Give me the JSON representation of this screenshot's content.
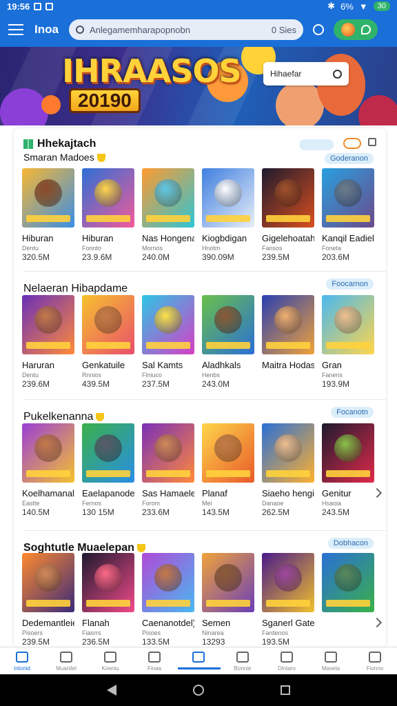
{
  "status": {
    "time": "19:56",
    "battery": "6%",
    "pill": "30"
  },
  "appbar": {
    "title": "Inoa",
    "search_placeholder": "Anlegamemharapopnobn",
    "search_right": "0 Sies"
  },
  "banner": {
    "title": "IHRAASOS",
    "year": "20190",
    "search_text": "Hihaefar"
  },
  "sections": [
    {
      "title": "Hhekajtach",
      "subtitle": "Smaran Madoes",
      "pill": "Goderanon",
      "cards": [
        {
          "name": "Hiburan",
          "meta": "Dentu",
          "size": "320.5M",
          "c1": "#f7b733",
          "c2": "#3a8ee6",
          "face": "#8b4a2a"
        },
        {
          "name": "Hiburan",
          "meta": "Fonnto",
          "size": "23.9.6M",
          "c1": "#2d6fd6",
          "c2": "#f35b9a",
          "face": "#ffd54a"
        },
        {
          "name": "Nas Hongena)",
          "meta": "Mornos",
          "size": "240.0M",
          "c1": "#ff9a2e",
          "c2": "#2ec4d6",
          "face": "#5fc9e8"
        },
        {
          "name": "Kiogbdigan",
          "meta": "Hnotm",
          "size": "390.09M",
          "c1": "#3f7fe0",
          "c2": "#e8eef8",
          "face": "#ffffff"
        },
        {
          "name": "Gigelehoatah",
          "meta": "Fansos",
          "size": "239.5M",
          "c1": "#1e1a2e",
          "c2": "#d94f1f",
          "face": "#a0522d"
        },
        {
          "name": "Kanqil Eadiel)",
          "meta": "Foneta",
          "size": "203.6M",
          "c1": "#2aa0e0",
          "c2": "#6b4a8a",
          "face": "#6e7b8a"
        }
      ]
    },
    {
      "title": "Nelaeran Hibapdame",
      "pill": "Foocarnon",
      "cards": [
        {
          "name": "Haruran",
          "meta": "Dentu",
          "size": "239.6M",
          "c1": "#6a2fb8",
          "c2": "#ff8a3a",
          "face": "#c47a4a"
        },
        {
          "name": "Genkatuile",
          "meta": "Rnnios",
          "size": "439.5M",
          "c1": "#f6c12e",
          "c2": "#e94f6b",
          "face": "#c47a4a"
        },
        {
          "name": "Sal Kamts",
          "meta": "Flniuco",
          "size": "237.5M",
          "c1": "#2ec4e6",
          "c2": "#d63fc6",
          "face": "#ffe14a"
        },
        {
          "name": "Aladhkals",
          "meta": "Henbs",
          "size": "243.0M",
          "c1": "#6ac04a",
          "c2": "#2a6fd6",
          "face": "#8b5a3a"
        },
        {
          "name": "Maitra Hodask",
          "meta": "",
          "size": "",
          "c1": "#2a3fb0",
          "c2": "#f0a23a",
          "face": "#f0b070"
        },
        {
          "name": "Gran",
          "meta": "Fanens",
          "size": "193.9M",
          "c1": "#4ab8f0",
          "c2": "#ffd54a",
          "face": "#f0c090"
        }
      ]
    },
    {
      "title": "Pukelkenanna",
      "pill": "Focanotn",
      "cards": [
        {
          "name": "Koelhamanal)",
          "meta": "Eastte",
          "size": "140.5M",
          "c1": "#9a3fd6",
          "c2": "#f5c12e",
          "face": "#c47a4a"
        },
        {
          "name": "Eaelapanodel)",
          "meta": "Fernos",
          "size": "130 15M",
          "c1": "#3ab04a",
          "c2": "#2a8ee6",
          "face": "#5a5a6a"
        },
        {
          "name": "Sas Hamaele",
          "meta": "Forom",
          "size": "233.6M",
          "c1": "#7a2fb8",
          "c2": "#ff8a3a",
          "face": "#d08a5a"
        },
        {
          "name": "Planaf",
          "meta": "Mei",
          "size": "143.5M",
          "c1": "#ffd54a",
          "c2": "#e85a2a",
          "face": "#c47a4a"
        },
        {
          "name": "Siaeho hengi",
          "meta": "Danaoe",
          "size": "262.5M",
          "c1": "#2a6fd6",
          "c2": "#ffb02e",
          "face": "#f0c090"
        },
        {
          "name": "Genitur",
          "meta": "Hsaoia",
          "size": "243.5M",
          "c1": "#1e1a2e",
          "c2": "#e02a4a",
          "face": "#8ac04a"
        }
      ]
    },
    {
      "title": "Soghtutle Muaelepan",
      "pill": "Dobhacon",
      "cards": [
        {
          "name": "Dedemantleie)",
          "meta": "Pisoers",
          "size": "239.5M",
          "c1": "#ff8a2e",
          "c2": "#3a2a7a",
          "face": "#d08a5a"
        },
        {
          "name": "Flanah",
          "meta": "Fiasrrs",
          "size": "236.5M",
          "c1": "#1e1a2e",
          "c2": "#f04a8a",
          "face": "#ff6a8a"
        },
        {
          "name": "Caenanotdel)",
          "meta": "Pisoes",
          "size": "133.5M",
          "c1": "#b04ad6",
          "c2": "#4ab8f0",
          "face": "#c47a4a"
        },
        {
          "name": "Semen",
          "meta": "Ninarea",
          "size": "13293",
          "c1": "#f0a23a",
          "c2": "#6a3fb8",
          "face": "#8b5a3a"
        },
        {
          "name": "Sganerl Gaten",
          "meta": "Fardenos",
          "size": "193.5M",
          "c1": "#4a1a8a",
          "c2": "#f0c02e",
          "face": "#a04aa0"
        },
        {
          "name": "",
          "meta": "",
          "size": "",
          "c1": "#2a6fd6",
          "c2": "#3ab04a",
          "face": "#5a8a5a"
        }
      ]
    }
  ],
  "bottom_nav": [
    {
      "label": "Intonid",
      "icon": "home-icon"
    },
    {
      "label": "Muanilel",
      "icon": "list-icon"
    },
    {
      "label": "Koeniu",
      "icon": "clock-icon"
    },
    {
      "label": "Finaa",
      "icon": "house-icon"
    },
    {
      "label": "",
      "icon": "grid-icon"
    },
    {
      "label": "Bonnie",
      "icon": "book-icon"
    },
    {
      "label": "Dintaro",
      "icon": "doc-icon"
    },
    {
      "label": "Maseta",
      "icon": "bag-icon"
    },
    {
      "label": "Fionno",
      "icon": "user-icon"
    }
  ],
  "colors": {
    "primary": "#1a6fd8",
    "accent_green": "#2fb36a"
  }
}
